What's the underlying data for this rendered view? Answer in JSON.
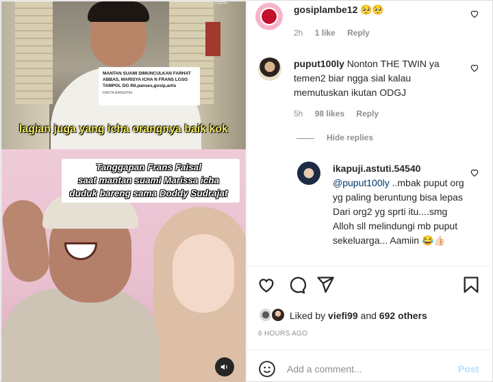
{
  "media": {
    "watermark": "CERITA",
    "top_caption_title": "MANTAN SUAMI DIMUNCULKAN FARHAT ABBAS, MARISYA ICHA N FRANS LGSG TAMPOL DG INI.panses,gosip,artis",
    "top_caption_source": "FAKTA BANGPIN",
    "subtitle": "lagian juga yang icha orangnya baik kok",
    "bottom_caption_lines": [
      "Tanggapan Frans Faisal",
      "saat mantan suami Marissa icha",
      "duduk bareng sama Doddy Sudrajat"
    ],
    "audio_icon": "speaker-icon"
  },
  "comments": [
    {
      "username": "gosiplambe12",
      "text": "🥺🥺",
      "time": "2h",
      "likes": "1 like",
      "reply": "Reply"
    },
    {
      "username": "puput100ly",
      "text": "Nonton THE TWIN ya temen2 biar ngga sial kalau memutuskan ikutan ODGJ",
      "time": "5h",
      "likes": "98 likes",
      "reply": "Reply"
    },
    {
      "username": "ikapuji.astuti.54540",
      "mention": "@puput100ly",
      "text": " ..mbak puput org yg paling beruntung bisa lepas Dari org2 yg sprti itu....smg Alloh sll melindungi mb puput sekeluarga... Aamiin 😂👍🏻"
    }
  ],
  "hide_replies": "Hide replies",
  "actions": {
    "like": "heart-icon",
    "comment": "comment-icon",
    "share": "send-icon",
    "save": "bookmark-icon"
  },
  "likes": {
    "prefix": "Liked by ",
    "user": "viefi99",
    "middle": " and ",
    "others": "692 others"
  },
  "posted_ago": "6 HOURS AGO",
  "composer": {
    "placeholder": "Add a comment...",
    "post_label": "Post",
    "emoji_icon": "emoji-icon"
  },
  "colors": {
    "text": "#262626",
    "muted": "#8e8e8e",
    "link": "#00376b",
    "post_disabled": "#b2dffc"
  }
}
